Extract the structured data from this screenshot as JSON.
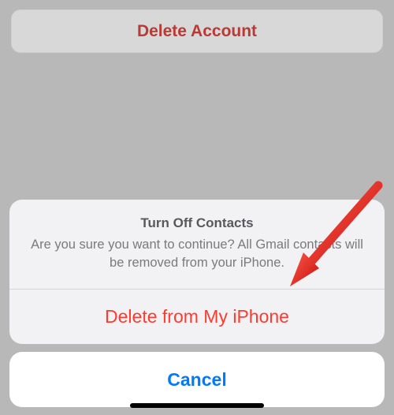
{
  "deleteAccount": {
    "label": "Delete Account"
  },
  "sheet": {
    "title": "Turn Off Contacts",
    "description": "Are you sure you want to continue? All Gmail contacts will be removed from your iPhone.",
    "destructiveLabel": "Delete from My iPhone",
    "cancelLabel": "Cancel"
  }
}
